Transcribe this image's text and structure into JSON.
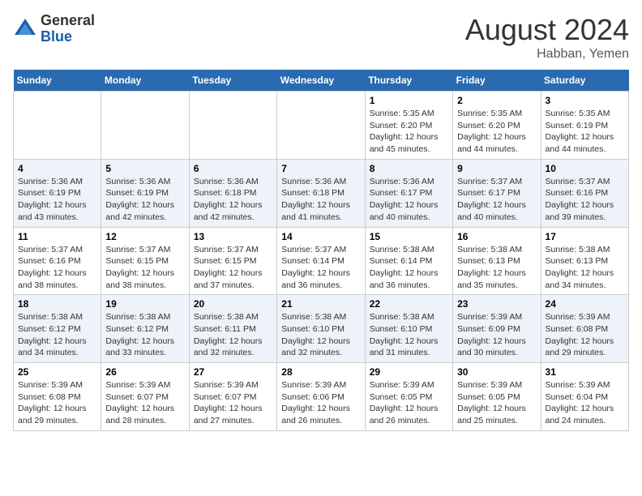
{
  "header": {
    "logo_general": "General",
    "logo_blue": "Blue",
    "month_title": "August 2024",
    "location": "Habban, Yemen"
  },
  "weekdays": [
    "Sunday",
    "Monday",
    "Tuesday",
    "Wednesday",
    "Thursday",
    "Friday",
    "Saturday"
  ],
  "weeks": [
    [
      {
        "day": "",
        "info": ""
      },
      {
        "day": "",
        "info": ""
      },
      {
        "day": "",
        "info": ""
      },
      {
        "day": "",
        "info": ""
      },
      {
        "day": "1",
        "info": "Sunrise: 5:35 AM\nSunset: 6:20 PM\nDaylight: 12 hours\nand 45 minutes."
      },
      {
        "day": "2",
        "info": "Sunrise: 5:35 AM\nSunset: 6:20 PM\nDaylight: 12 hours\nand 44 minutes."
      },
      {
        "day": "3",
        "info": "Sunrise: 5:35 AM\nSunset: 6:19 PM\nDaylight: 12 hours\nand 44 minutes."
      }
    ],
    [
      {
        "day": "4",
        "info": "Sunrise: 5:36 AM\nSunset: 6:19 PM\nDaylight: 12 hours\nand 43 minutes."
      },
      {
        "day": "5",
        "info": "Sunrise: 5:36 AM\nSunset: 6:19 PM\nDaylight: 12 hours\nand 42 minutes."
      },
      {
        "day": "6",
        "info": "Sunrise: 5:36 AM\nSunset: 6:18 PM\nDaylight: 12 hours\nand 42 minutes."
      },
      {
        "day": "7",
        "info": "Sunrise: 5:36 AM\nSunset: 6:18 PM\nDaylight: 12 hours\nand 41 minutes."
      },
      {
        "day": "8",
        "info": "Sunrise: 5:36 AM\nSunset: 6:17 PM\nDaylight: 12 hours\nand 40 minutes."
      },
      {
        "day": "9",
        "info": "Sunrise: 5:37 AM\nSunset: 6:17 PM\nDaylight: 12 hours\nand 40 minutes."
      },
      {
        "day": "10",
        "info": "Sunrise: 5:37 AM\nSunset: 6:16 PM\nDaylight: 12 hours\nand 39 minutes."
      }
    ],
    [
      {
        "day": "11",
        "info": "Sunrise: 5:37 AM\nSunset: 6:16 PM\nDaylight: 12 hours\nand 38 minutes."
      },
      {
        "day": "12",
        "info": "Sunrise: 5:37 AM\nSunset: 6:15 PM\nDaylight: 12 hours\nand 38 minutes."
      },
      {
        "day": "13",
        "info": "Sunrise: 5:37 AM\nSunset: 6:15 PM\nDaylight: 12 hours\nand 37 minutes."
      },
      {
        "day": "14",
        "info": "Sunrise: 5:37 AM\nSunset: 6:14 PM\nDaylight: 12 hours\nand 36 minutes."
      },
      {
        "day": "15",
        "info": "Sunrise: 5:38 AM\nSunset: 6:14 PM\nDaylight: 12 hours\nand 36 minutes."
      },
      {
        "day": "16",
        "info": "Sunrise: 5:38 AM\nSunset: 6:13 PM\nDaylight: 12 hours\nand 35 minutes."
      },
      {
        "day": "17",
        "info": "Sunrise: 5:38 AM\nSunset: 6:13 PM\nDaylight: 12 hours\nand 34 minutes."
      }
    ],
    [
      {
        "day": "18",
        "info": "Sunrise: 5:38 AM\nSunset: 6:12 PM\nDaylight: 12 hours\nand 34 minutes."
      },
      {
        "day": "19",
        "info": "Sunrise: 5:38 AM\nSunset: 6:12 PM\nDaylight: 12 hours\nand 33 minutes."
      },
      {
        "day": "20",
        "info": "Sunrise: 5:38 AM\nSunset: 6:11 PM\nDaylight: 12 hours\nand 32 minutes."
      },
      {
        "day": "21",
        "info": "Sunrise: 5:38 AM\nSunset: 6:10 PM\nDaylight: 12 hours\nand 32 minutes."
      },
      {
        "day": "22",
        "info": "Sunrise: 5:38 AM\nSunset: 6:10 PM\nDaylight: 12 hours\nand 31 minutes."
      },
      {
        "day": "23",
        "info": "Sunrise: 5:39 AM\nSunset: 6:09 PM\nDaylight: 12 hours\nand 30 minutes."
      },
      {
        "day": "24",
        "info": "Sunrise: 5:39 AM\nSunset: 6:08 PM\nDaylight: 12 hours\nand 29 minutes."
      }
    ],
    [
      {
        "day": "25",
        "info": "Sunrise: 5:39 AM\nSunset: 6:08 PM\nDaylight: 12 hours\nand 29 minutes."
      },
      {
        "day": "26",
        "info": "Sunrise: 5:39 AM\nSunset: 6:07 PM\nDaylight: 12 hours\nand 28 minutes."
      },
      {
        "day": "27",
        "info": "Sunrise: 5:39 AM\nSunset: 6:07 PM\nDaylight: 12 hours\nand 27 minutes."
      },
      {
        "day": "28",
        "info": "Sunrise: 5:39 AM\nSunset: 6:06 PM\nDaylight: 12 hours\nand 26 minutes."
      },
      {
        "day": "29",
        "info": "Sunrise: 5:39 AM\nSunset: 6:05 PM\nDaylight: 12 hours\nand 26 minutes."
      },
      {
        "day": "30",
        "info": "Sunrise: 5:39 AM\nSunset: 6:05 PM\nDaylight: 12 hours\nand 25 minutes."
      },
      {
        "day": "31",
        "info": "Sunrise: 5:39 AM\nSunset: 6:04 PM\nDaylight: 12 hours\nand 24 minutes."
      }
    ]
  ]
}
